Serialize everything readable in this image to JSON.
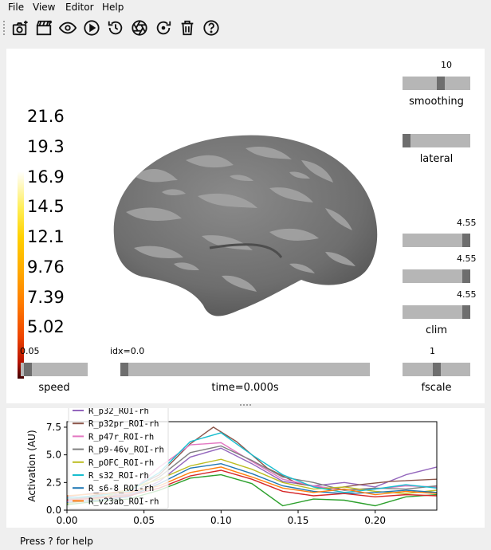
{
  "menu": [
    "File",
    "View",
    "Editor",
    "Help"
  ],
  "toolbar": [
    {
      "icon": "screenshot-icon"
    },
    {
      "icon": "movie-icon"
    },
    {
      "icon": "eye-icon"
    },
    {
      "icon": "play-icon"
    },
    {
      "icon": "history-icon"
    },
    {
      "icon": "shutter-icon"
    },
    {
      "icon": "reset-icon"
    },
    {
      "icon": "trash-icon"
    },
    {
      "icon": "help-icon"
    }
  ],
  "colorbar": {
    "labels": [
      "21.6",
      "19.3",
      "16.9",
      "14.5",
      "12.1",
      "9.76",
      "7.39",
      "5.02"
    ],
    "colormap": "hot"
  },
  "sliders": {
    "smoothing": {
      "label": "smoothing",
      "value": "10",
      "level": 0.57
    },
    "lateral": {
      "label": "lateral",
      "level": 0.0
    },
    "clim_top": {
      "value": "4.55",
      "level": 1.0
    },
    "clim_mid": {
      "value": "4.55",
      "level": 1.0
    },
    "clim_bottom": {
      "value": "4.55",
      "level": 1.0
    },
    "clim_label": "clim",
    "speed": {
      "label": "speed",
      "value": "0.05",
      "level": 0.05
    },
    "time": {
      "label": "time=0.000s",
      "value": "idx=0.0",
      "level": 0.0
    },
    "fscale": {
      "label": "fscale",
      "value": "1",
      "level": 0.5
    }
  },
  "status": "Press ? for help",
  "chart_data": {
    "type": "line",
    "ylabel": "Activation (AU)",
    "xlabel": "",
    "xlim": [
      0.0,
      0.24
    ],
    "ylim": [
      0.0,
      8.0
    ],
    "xticks": [
      "0.00",
      "0.05",
      "0.10",
      "0.15",
      "0.20"
    ],
    "yticks": [
      "0.0",
      "2.5",
      "5.0",
      "7.5"
    ],
    "legend": [
      "R_p32_ROI-rh",
      "R_p32pr_ROI-rh",
      "R_p47r_ROI-rh",
      "R_p9-46v_ROI-rh",
      "R_pOFC_ROI-rh",
      "R_s32_ROI-rh",
      "R_s6-8_ROI-rh",
      "R_v23ab_ROI-rh"
    ],
    "legend_position": "upper-left",
    "colors": [
      "#9467bd",
      "#8c564b",
      "#e377c2",
      "#7f7f7f",
      "#bcbd22",
      "#17becf",
      "#1f77b4",
      "#ff7f0e",
      "#2ca02c",
      "#d62728"
    ],
    "series": [
      {
        "name": "R_p32_ROI-rh",
        "values": [
          [
            0.0,
            1.2
          ],
          [
            0.02,
            1.6
          ],
          [
            0.04,
            1.3
          ],
          [
            0.06,
            2.6
          ],
          [
            0.08,
            4.8
          ],
          [
            0.1,
            5.6
          ],
          [
            0.12,
            4.2
          ],
          [
            0.14,
            2.6
          ],
          [
            0.16,
            2.2
          ],
          [
            0.18,
            2.5
          ],
          [
            0.2,
            2.1
          ],
          [
            0.22,
            3.2
          ],
          [
            0.24,
            3.9
          ]
        ]
      },
      {
        "name": "R_p32pr_ROI-rh",
        "values": [
          [
            0.0,
            0.9
          ],
          [
            0.02,
            1.4
          ],
          [
            0.04,
            1.8
          ],
          [
            0.06,
            3.2
          ],
          [
            0.08,
            6.0
          ],
          [
            0.095,
            7.5
          ],
          [
            0.11,
            6.2
          ],
          [
            0.13,
            3.8
          ],
          [
            0.15,
            2.4
          ],
          [
            0.17,
            1.9
          ],
          [
            0.19,
            2.3
          ],
          [
            0.21,
            2.6
          ],
          [
            0.24,
            2.8
          ]
        ]
      },
      {
        "name": "R_p47r_ROI-rh",
        "values": [
          [
            0.0,
            0.8
          ],
          [
            0.02,
            1.1
          ],
          [
            0.04,
            1.5
          ],
          [
            0.06,
            3.9
          ],
          [
            0.08,
            5.9
          ],
          [
            0.1,
            6.1
          ],
          [
            0.12,
            4.4
          ],
          [
            0.14,
            2.8
          ],
          [
            0.16,
            2.2
          ],
          [
            0.18,
            1.8
          ],
          [
            0.2,
            1.9
          ],
          [
            0.22,
            2.2
          ],
          [
            0.24,
            2.1
          ]
        ]
      },
      {
        "name": "R_p9-46v_ROI-rh",
        "values": [
          [
            0.0,
            1.0
          ],
          [
            0.02,
            1.2
          ],
          [
            0.04,
            1.4
          ],
          [
            0.06,
            3.0
          ],
          [
            0.08,
            5.2
          ],
          [
            0.1,
            5.8
          ],
          [
            0.12,
            4.5
          ],
          [
            0.14,
            3.0
          ],
          [
            0.16,
            2.5
          ],
          [
            0.18,
            1.8
          ],
          [
            0.2,
            2.0
          ],
          [
            0.22,
            1.9
          ],
          [
            0.24,
            2.2
          ]
        ]
      },
      {
        "name": "R_pOFC_ROI-rh",
        "values": [
          [
            0.0,
            0.6
          ],
          [
            0.02,
            1.0
          ],
          [
            0.04,
            1.9
          ],
          [
            0.06,
            2.8
          ],
          [
            0.08,
            4.0
          ],
          [
            0.1,
            4.6
          ],
          [
            0.12,
            3.7
          ],
          [
            0.14,
            2.5
          ],
          [
            0.16,
            1.9
          ],
          [
            0.18,
            2.1
          ],
          [
            0.2,
            1.7
          ],
          [
            0.22,
            1.5
          ],
          [
            0.24,
            1.8
          ]
        ]
      },
      {
        "name": "R_s32_ROI-rh",
        "values": [
          [
            0.0,
            1.1
          ],
          [
            0.02,
            1.3
          ],
          [
            0.04,
            1.7
          ],
          [
            0.06,
            3.4
          ],
          [
            0.08,
            6.2
          ],
          [
            0.1,
            7.0
          ],
          [
            0.12,
            5.0
          ],
          [
            0.14,
            3.2
          ],
          [
            0.16,
            2.1
          ],
          [
            0.18,
            1.6
          ],
          [
            0.2,
            1.9
          ],
          [
            0.22,
            2.3
          ],
          [
            0.24,
            2.0
          ]
        ]
      },
      {
        "name": "R_s6-8_ROI-rh",
        "values": [
          [
            0.0,
            0.7
          ],
          [
            0.02,
            0.9
          ],
          [
            0.04,
            1.2
          ],
          [
            0.06,
            2.4
          ],
          [
            0.08,
            3.8
          ],
          [
            0.1,
            4.2
          ],
          [
            0.12,
            3.3
          ],
          [
            0.14,
            2.2
          ],
          [
            0.16,
            1.7
          ],
          [
            0.18,
            1.5
          ],
          [
            0.2,
            1.6
          ],
          [
            0.22,
            1.8
          ],
          [
            0.24,
            1.6
          ]
        ]
      },
      {
        "name": "R_v23ab_ROI-rh",
        "values": [
          [
            0.0,
            1.3
          ],
          [
            0.02,
            1.5
          ],
          [
            0.04,
            1.6
          ],
          [
            0.06,
            2.2
          ],
          [
            0.08,
            3.4
          ],
          [
            0.1,
            3.9
          ],
          [
            0.12,
            3.0
          ],
          [
            0.14,
            2.0
          ],
          [
            0.16,
            1.6
          ],
          [
            0.18,
            1.9
          ],
          [
            0.2,
            1.4
          ],
          [
            0.22,
            1.7
          ],
          [
            0.24,
            1.5
          ]
        ]
      },
      {
        "name": "",
        "values": [
          [
            0.0,
            0.5
          ],
          [
            0.02,
            0.8
          ],
          [
            0.04,
            1.0
          ],
          [
            0.06,
            1.8
          ],
          [
            0.08,
            2.9
          ],
          [
            0.1,
            3.2
          ],
          [
            0.12,
            2.4
          ],
          [
            0.14,
            0.4
          ],
          [
            0.16,
            1.0
          ],
          [
            0.18,
            0.9
          ],
          [
            0.2,
            0.4
          ],
          [
            0.22,
            1.2
          ],
          [
            0.24,
            1.4
          ]
        ]
      },
      {
        "name": "",
        "values": [
          [
            0.0,
            0.9
          ],
          [
            0.02,
            1.1
          ],
          [
            0.04,
            1.3
          ],
          [
            0.06,
            2.0
          ],
          [
            0.08,
            3.1
          ],
          [
            0.1,
            3.6
          ],
          [
            0.12,
            2.8
          ],
          [
            0.14,
            1.7
          ],
          [
            0.16,
            1.3
          ],
          [
            0.18,
            1.5
          ],
          [
            0.2,
            1.2
          ],
          [
            0.22,
            1.4
          ],
          [
            0.24,
            1.3
          ]
        ]
      }
    ]
  }
}
